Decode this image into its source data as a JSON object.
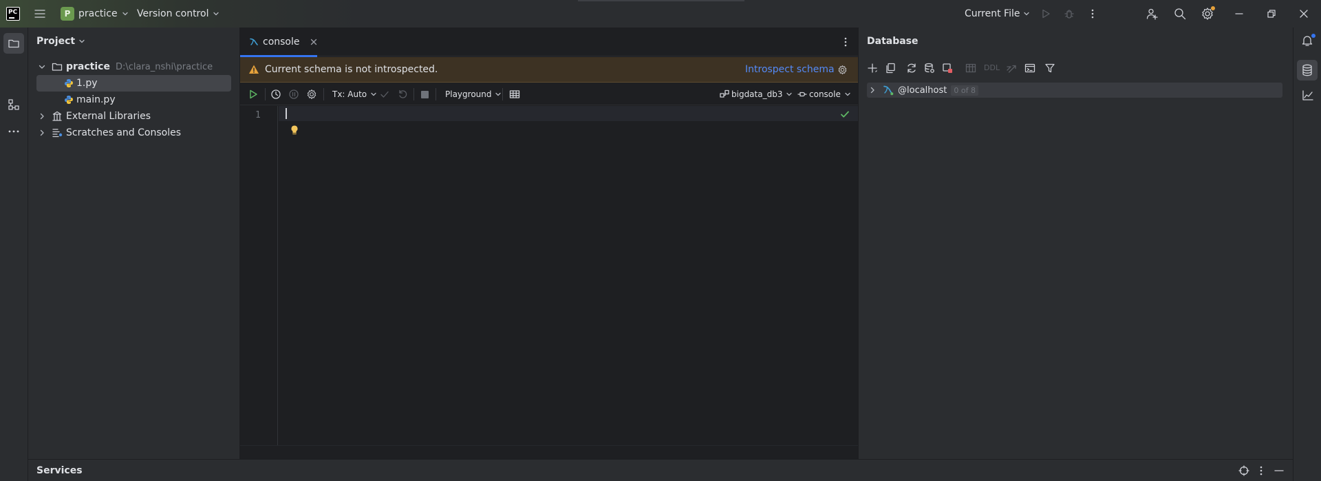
{
  "titlebar": {
    "app_logo": "PC",
    "project_badge": "P",
    "project_name": "practice",
    "vcs_label": "Version control",
    "run_config": "Current File",
    "accent": "#6b9a4f"
  },
  "project_panel": {
    "title": "Project",
    "tree": {
      "root_name": "practice",
      "root_path": "D:\\clara_nshi\\practice",
      "files": [
        "1.py",
        "main.py"
      ],
      "external_libraries": "External Libraries",
      "scratches": "Scratches and Consoles"
    }
  },
  "editor": {
    "tab_label": "console",
    "warning_text": "Current schema is not introspected.",
    "introspect_link": "Introspect schema",
    "toolbar": {
      "tx_label": "Tx: Auto",
      "playground_label": "Playground",
      "datasource_label": "bigdata_db3",
      "session_label": "console"
    },
    "line_number": "1",
    "colors": {
      "warning_bg": "#3d3223",
      "link": "#548af7",
      "tab_underline": "#3574f0"
    }
  },
  "database_panel": {
    "title": "Database",
    "ddl_label": "DDL",
    "datasource": {
      "name": "@localhost",
      "count": "0 of 8"
    }
  },
  "services": {
    "title": "Services"
  }
}
